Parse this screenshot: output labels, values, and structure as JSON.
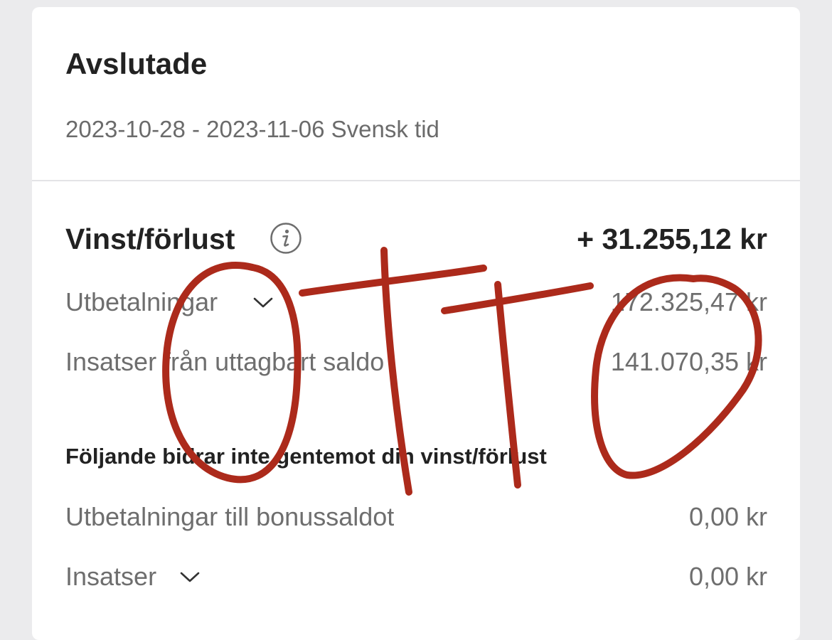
{
  "summary": {
    "title": "Avslutade",
    "period": "2023-10-28 - 2023-11-06 Svensk tid",
    "profit_loss": {
      "label": "Vinst/förlust",
      "value": "+ 31.255,12 kr",
      "icon": "info-icon"
    },
    "rows": [
      {
        "label": "Utbetalningar",
        "value": "172.325,47 kr",
        "expandable": true
      },
      {
        "label": "Insatser från uttagbart saldo",
        "value": "141.070,35 kr",
        "expandable": false
      }
    ],
    "non_contributing": {
      "heading": "Följande bidrar inte gentemot din vinst/förlust",
      "rows": [
        {
          "label": "Utbetalningar till bonussaldot",
          "value": "0,00 kr",
          "expandable": false
        },
        {
          "label": "Insatser",
          "value": "0,00 kr",
          "expandable": true
        }
      ]
    }
  },
  "annotation": {
    "handwritten_text": "OTTO",
    "color": "#ac2a1b"
  }
}
